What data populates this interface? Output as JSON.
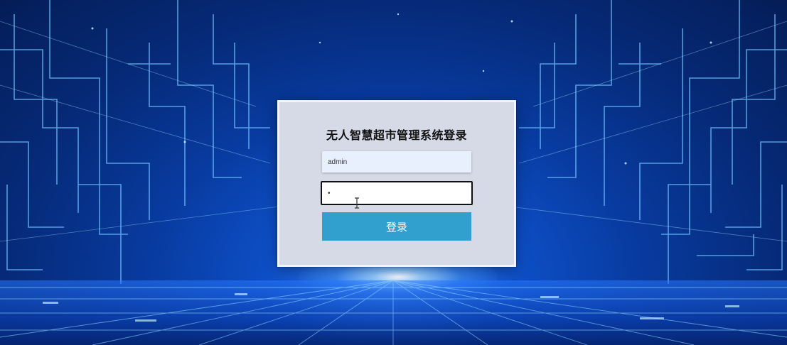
{
  "login": {
    "title": "无人智慧超市管理系统登录",
    "username_value": "admin",
    "password_value": "•",
    "submit_label": "登录"
  },
  "colors": {
    "panel_bg": "#d5dae6",
    "username_bg": "#e8f0fe",
    "button_bg": "#31a0ce",
    "background_blue": "#0b4bbf"
  },
  "icons": {
    "cursor": "text-cursor-icon"
  }
}
